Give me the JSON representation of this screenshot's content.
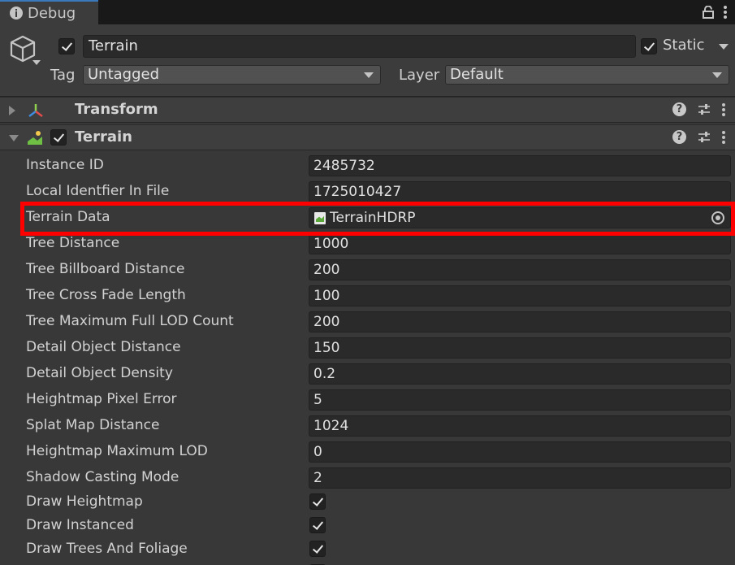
{
  "tab": {
    "title": "Debug"
  },
  "header": {
    "name": "Terrain",
    "static_label": "Static",
    "tag_label": "Tag",
    "tag_value": "Untagged",
    "layer_label": "Layer",
    "layer_value": "Default"
  },
  "components": {
    "transform": {
      "title": "Transform"
    },
    "terrain": {
      "title": "Terrain"
    }
  },
  "properties": [
    {
      "label": "Instance ID",
      "value": "2485732"
    },
    {
      "label": "Local Identfier In File",
      "value": "1725010427"
    },
    {
      "label": "Terrain Data",
      "value": "TerrainHDRP"
    },
    {
      "label": "Tree Distance",
      "value": "1000"
    },
    {
      "label": "Tree Billboard Distance",
      "value": "200"
    },
    {
      "label": "Tree Cross Fade Length",
      "value": "100"
    },
    {
      "label": "Tree Maximum Full LOD Count",
      "value": "200"
    },
    {
      "label": "Detail Object Distance",
      "value": "150"
    },
    {
      "label": "Detail Object Density",
      "value": "0.2"
    },
    {
      "label": "Heightmap Pixel Error",
      "value": "5"
    },
    {
      "label": "Splat Map Distance",
      "value": "1024"
    },
    {
      "label": "Heightmap Maximum LOD",
      "value": "0"
    },
    {
      "label": "Shadow Casting Mode",
      "value": "2"
    },
    {
      "label": "Draw Heightmap",
      "checked": true
    },
    {
      "label": "Draw Instanced",
      "checked": true
    },
    {
      "label": "Draw Trees And Foliage",
      "checked": true
    }
  ],
  "colors": {
    "highlight": "#ff0000",
    "tab_accent": "#3a79bb",
    "panel": "#383838"
  }
}
